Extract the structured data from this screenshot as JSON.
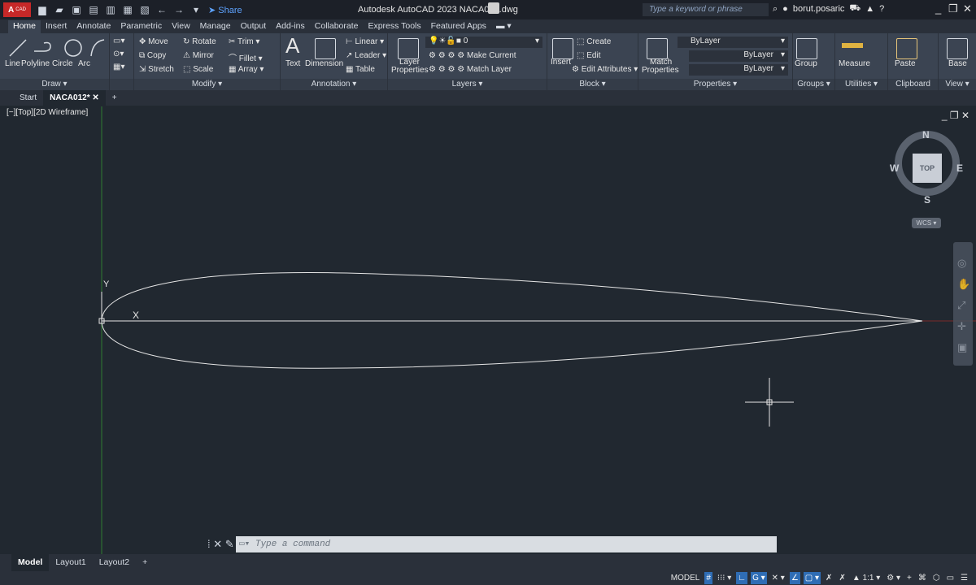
{
  "titlebar": {
    "logo": "A",
    "logo_sub": "CAD",
    "share": "Share",
    "title": "Autodesk AutoCAD 2023   NACA012.dwg",
    "search_placeholder": "Type a keyword or phrase",
    "user": "borut.posaric"
  },
  "ribbon_tabs": [
    "Home",
    "Insert",
    "Annotate",
    "Parametric",
    "View",
    "Manage",
    "Output",
    "Add-ins",
    "Collaborate",
    "Express Tools",
    "Featured Apps"
  ],
  "ribbon": {
    "draw": {
      "label": "Draw",
      "line": "Line",
      "polyline": "Polyline",
      "circle": "Circle",
      "arc": "Arc"
    },
    "modify": {
      "label": "Modify",
      "move": "Move",
      "rotate": "Rotate",
      "trim": "Trim",
      "copy": "Copy",
      "mirror": "Mirror",
      "fillet": "Fillet",
      "stretch": "Stretch",
      "scale": "Scale",
      "array": "Array"
    },
    "annotation": {
      "label": "Annotation",
      "text": "Text",
      "dimension": "Dimension",
      "linear": "Linear",
      "leader": "Leader",
      "table": "Table"
    },
    "layers": {
      "label": "Layers",
      "layer_properties_1": "Layer",
      "layer_properties_2": "Properties",
      "current_layer": "0",
      "make_current": "Make Current",
      "match_layer": "Match Layer"
    },
    "block": {
      "label": "Block",
      "insert": "Insert",
      "create": "Create",
      "edit": "Edit",
      "edit_attributes": "Edit Attributes"
    },
    "properties": {
      "label": "Properties",
      "match_1": "Match",
      "match_2": "Properties",
      "color": "ByLayer",
      "linetype": "ByLayer",
      "lineweight": "ByLayer"
    },
    "groups": {
      "label": "Groups",
      "group": "Group"
    },
    "utilities": {
      "label": "Utilities",
      "measure": "Measure"
    },
    "clipboard": {
      "label": "Clipboard",
      "paste": "Paste"
    },
    "view": {
      "label": "View",
      "base": "Base"
    }
  },
  "doc_tabs": {
    "start": "Start",
    "active": "NACA012*"
  },
  "viewport": {
    "label": "[−][Top][2D Wireframe]",
    "compass": {
      "n": "N",
      "s": "S",
      "e": "E",
      "w": "W",
      "cube": "TOP",
      "wcs": "WCS"
    },
    "ucs": {
      "x": "X",
      "y": "Y"
    }
  },
  "command": {
    "placeholder": "Type a command"
  },
  "layout_tabs": [
    "Model",
    "Layout1",
    "Layout2"
  ],
  "status": {
    "model": "MODEL",
    "scale": "1:1"
  }
}
